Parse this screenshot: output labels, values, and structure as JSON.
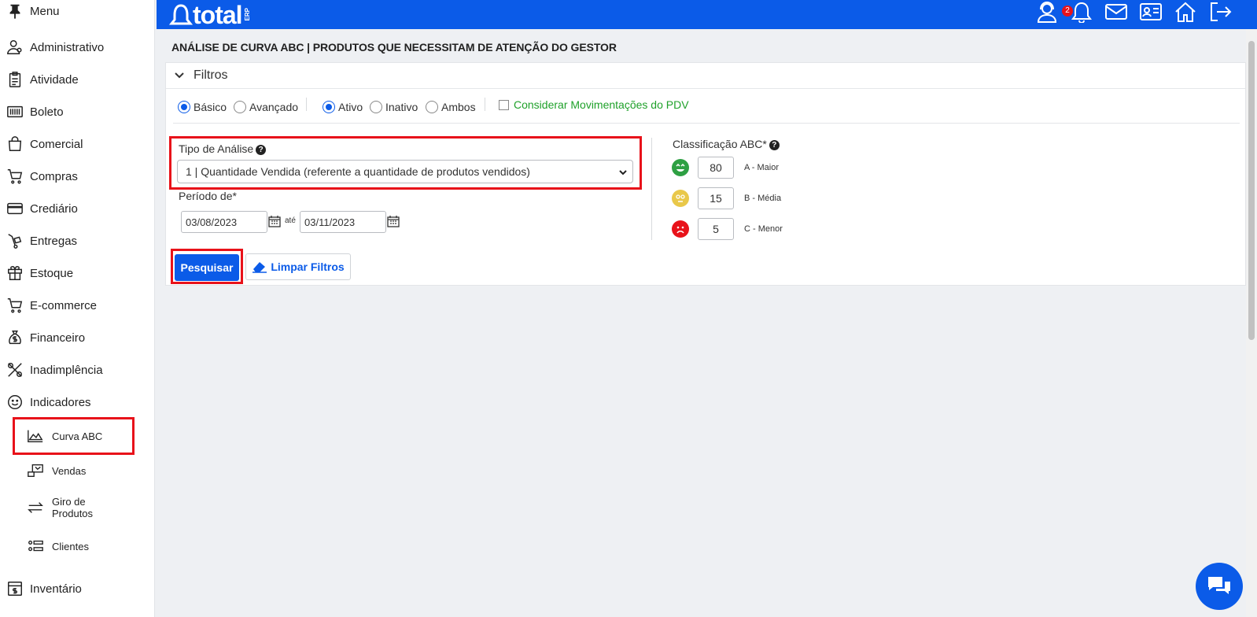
{
  "sidebar": {
    "menu_label": "Menu",
    "items": [
      {
        "label": "Administrativo"
      },
      {
        "label": "Atividade"
      },
      {
        "label": "Boleto"
      },
      {
        "label": "Comercial"
      },
      {
        "label": "Compras"
      },
      {
        "label": "Crediário"
      },
      {
        "label": "Entregas"
      },
      {
        "label": "Estoque"
      },
      {
        "label": "E-commerce"
      },
      {
        "label": "Financeiro"
      },
      {
        "label": "Inadimplência"
      },
      {
        "label": "Indicadores"
      }
    ],
    "subitems": [
      {
        "label": "Curva ABC"
      },
      {
        "label": "Vendas"
      },
      {
        "label": "Giro de Produtos"
      },
      {
        "label": "Clientes"
      }
    ],
    "last_item": {
      "label": "Inventário"
    }
  },
  "header": {
    "logo_text": "total",
    "logo_sub": "ERP",
    "notification_count": "2",
    "icons": [
      "user-support-icon",
      "bell-icon",
      "mail-icon",
      "id-card-icon",
      "home-icon",
      "logout-icon"
    ],
    "brand_color": "#0b5be8"
  },
  "page": {
    "title": "ANÁLISE DE CURVA ABC | PRODUTOS QUE NECESSITAM DE ATENÇÃO DO GESTOR"
  },
  "filters": {
    "section_label": "Filtros",
    "mode_options": [
      {
        "label": "Básico",
        "selected": true
      },
      {
        "label": "Avançado",
        "selected": false
      }
    ],
    "status_options": [
      {
        "label": "Ativo",
        "selected": true
      },
      {
        "label": "Inativo",
        "selected": false
      },
      {
        "label": "Ambos",
        "selected": false
      }
    ],
    "pdv_checkbox_label": "Considerar Movimentações do PDV",
    "pdv_checked": false,
    "analysis_type_label": "Tipo de Análise",
    "analysis_type_value": "1 | Quantidade Vendida (referente a quantidade de produtos vendidos)",
    "period_label": "Período de*",
    "date_from": "03/08/2023",
    "date_sep": "até",
    "date_to": "03/11/2023",
    "abc_label": "Classificação ABC*",
    "abc_rows": [
      {
        "value": "80",
        "label": "A - Maior",
        "color": "#2ea043"
      },
      {
        "value": "15",
        "label": "B - Média",
        "color": "#e9c84a"
      },
      {
        "value": "5",
        "label": "C - Menor",
        "color": "#e8121a"
      }
    ],
    "search_button": "Pesquisar",
    "clear_button": "Limpar Filtros"
  }
}
